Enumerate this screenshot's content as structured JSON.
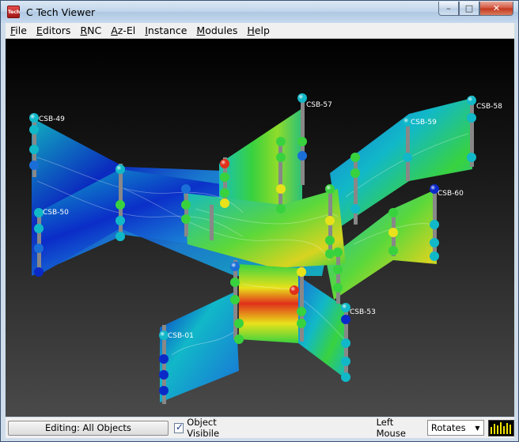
{
  "window": {
    "title": "C Tech Viewer",
    "icon_label": "Tech",
    "buttons": {
      "minimize": "–",
      "maximize": "□",
      "close": "✕"
    }
  },
  "menu": [
    "File",
    "Editors",
    "RNC",
    "Az-El",
    "Instance",
    "Modules",
    "Help"
  ],
  "menu_hotkeys": [
    "F",
    "E",
    "R",
    "A",
    "I",
    "M",
    "H"
  ],
  "viewport": {
    "labels": [
      "CSB-49",
      "CSB-57",
      "CSB-58",
      "CSB-59",
      "CSB-60",
      "CSB-50",
      "CSB-53",
      "CSB-01"
    ],
    "colors": {
      "blue": "#0a2ac8",
      "cyan": "#11b8c8",
      "green": "#39d23f",
      "yellow": "#e8e21a",
      "red": "#e0301a"
    }
  },
  "status": {
    "editing_label": "Editing: All Objects",
    "object_visible_label": "Object Visibile",
    "object_visible_checked": true,
    "left_mouse_label": "Left Mouse",
    "left_mouse_mode": "Rotates"
  }
}
